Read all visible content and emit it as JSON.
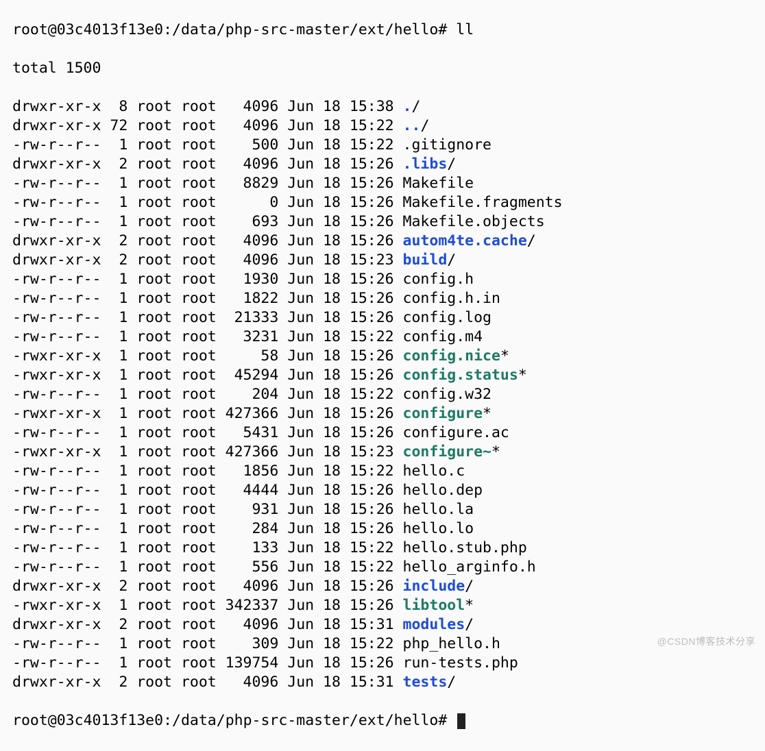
{
  "prompt": {
    "user": "root",
    "host": "03c4013f13e0",
    "path": "/data/php-src-master/ext/hello",
    "symbol": "#"
  },
  "command": "ll",
  "total_line": "total 1500",
  "colors": {
    "dir": "#1f4bd9",
    "exec": "#1d7a65"
  },
  "entries": [
    {
      "perms": "drwxr-xr-x",
      "links": 8,
      "owner": "root",
      "group": "root",
      "size": 4096,
      "date": "Jun 18 15:38",
      "name": ".",
      "suffix": "/",
      "type": "dir"
    },
    {
      "perms": "drwxr-xr-x",
      "links": 72,
      "owner": "root",
      "group": "root",
      "size": 4096,
      "date": "Jun 18 15:22",
      "name": "..",
      "suffix": "/",
      "type": "dir"
    },
    {
      "perms": "-rw-r--r--",
      "links": 1,
      "owner": "root",
      "group": "root",
      "size": 500,
      "date": "Jun 18 15:22",
      "name": ".gitignore",
      "suffix": "",
      "type": "file"
    },
    {
      "perms": "drwxr-xr-x",
      "links": 2,
      "owner": "root",
      "group": "root",
      "size": 4096,
      "date": "Jun 18 15:26",
      "name": ".libs",
      "suffix": "/",
      "type": "dir"
    },
    {
      "perms": "-rw-r--r--",
      "links": 1,
      "owner": "root",
      "group": "root",
      "size": 8829,
      "date": "Jun 18 15:26",
      "name": "Makefile",
      "suffix": "",
      "type": "file"
    },
    {
      "perms": "-rw-r--r--",
      "links": 1,
      "owner": "root",
      "group": "root",
      "size": 0,
      "date": "Jun 18 15:26",
      "name": "Makefile.fragments",
      "suffix": "",
      "type": "file"
    },
    {
      "perms": "-rw-r--r--",
      "links": 1,
      "owner": "root",
      "group": "root",
      "size": 693,
      "date": "Jun 18 15:26",
      "name": "Makefile.objects",
      "suffix": "",
      "type": "file"
    },
    {
      "perms": "drwxr-xr-x",
      "links": 2,
      "owner": "root",
      "group": "root",
      "size": 4096,
      "date": "Jun 18 15:26",
      "name": "autom4te.cache",
      "suffix": "/",
      "type": "dir"
    },
    {
      "perms": "drwxr-xr-x",
      "links": 2,
      "owner": "root",
      "group": "root",
      "size": 4096,
      "date": "Jun 18 15:23",
      "name": "build",
      "suffix": "/",
      "type": "dir"
    },
    {
      "perms": "-rw-r--r--",
      "links": 1,
      "owner": "root",
      "group": "root",
      "size": 1930,
      "date": "Jun 18 15:26",
      "name": "config.h",
      "suffix": "",
      "type": "file"
    },
    {
      "perms": "-rw-r--r--",
      "links": 1,
      "owner": "root",
      "group": "root",
      "size": 1822,
      "date": "Jun 18 15:26",
      "name": "config.h.in",
      "suffix": "",
      "type": "file"
    },
    {
      "perms": "-rw-r--r--",
      "links": 1,
      "owner": "root",
      "group": "root",
      "size": 21333,
      "date": "Jun 18 15:26",
      "name": "config.log",
      "suffix": "",
      "type": "file"
    },
    {
      "perms": "-rw-r--r--",
      "links": 1,
      "owner": "root",
      "group": "root",
      "size": 3231,
      "date": "Jun 18 15:22",
      "name": "config.m4",
      "suffix": "",
      "type": "file"
    },
    {
      "perms": "-rwxr-xr-x",
      "links": 1,
      "owner": "root",
      "group": "root",
      "size": 58,
      "date": "Jun 18 15:26",
      "name": "config.nice",
      "suffix": "*",
      "type": "exec"
    },
    {
      "perms": "-rwxr-xr-x",
      "links": 1,
      "owner": "root",
      "group": "root",
      "size": 45294,
      "date": "Jun 18 15:26",
      "name": "config.status",
      "suffix": "*",
      "type": "exec"
    },
    {
      "perms": "-rw-r--r--",
      "links": 1,
      "owner": "root",
      "group": "root",
      "size": 204,
      "date": "Jun 18 15:22",
      "name": "config.w32",
      "suffix": "",
      "type": "file"
    },
    {
      "perms": "-rwxr-xr-x",
      "links": 1,
      "owner": "root",
      "group": "root",
      "size": 427366,
      "date": "Jun 18 15:26",
      "name": "configure",
      "suffix": "*",
      "type": "exec"
    },
    {
      "perms": "-rw-r--r--",
      "links": 1,
      "owner": "root",
      "group": "root",
      "size": 5431,
      "date": "Jun 18 15:26",
      "name": "configure.ac",
      "suffix": "",
      "type": "file"
    },
    {
      "perms": "-rwxr-xr-x",
      "links": 1,
      "owner": "root",
      "group": "root",
      "size": 427366,
      "date": "Jun 18 15:23",
      "name": "configure~",
      "suffix": "*",
      "type": "exec"
    },
    {
      "perms": "-rw-r--r--",
      "links": 1,
      "owner": "root",
      "group": "root",
      "size": 1856,
      "date": "Jun 18 15:22",
      "name": "hello.c",
      "suffix": "",
      "type": "file"
    },
    {
      "perms": "-rw-r--r--",
      "links": 1,
      "owner": "root",
      "group": "root",
      "size": 4444,
      "date": "Jun 18 15:26",
      "name": "hello.dep",
      "suffix": "",
      "type": "file"
    },
    {
      "perms": "-rw-r--r--",
      "links": 1,
      "owner": "root",
      "group": "root",
      "size": 931,
      "date": "Jun 18 15:26",
      "name": "hello.la",
      "suffix": "",
      "type": "file"
    },
    {
      "perms": "-rw-r--r--",
      "links": 1,
      "owner": "root",
      "group": "root",
      "size": 284,
      "date": "Jun 18 15:26",
      "name": "hello.lo",
      "suffix": "",
      "type": "file"
    },
    {
      "perms": "-rw-r--r--",
      "links": 1,
      "owner": "root",
      "group": "root",
      "size": 133,
      "date": "Jun 18 15:22",
      "name": "hello.stub.php",
      "suffix": "",
      "type": "file"
    },
    {
      "perms": "-rw-r--r--",
      "links": 1,
      "owner": "root",
      "group": "root",
      "size": 556,
      "date": "Jun 18 15:22",
      "name": "hello_arginfo.h",
      "suffix": "",
      "type": "file"
    },
    {
      "perms": "drwxr-xr-x",
      "links": 2,
      "owner": "root",
      "group": "root",
      "size": 4096,
      "date": "Jun 18 15:26",
      "name": "include",
      "suffix": "/",
      "type": "dir"
    },
    {
      "perms": "-rwxr-xr-x",
      "links": 1,
      "owner": "root",
      "group": "root",
      "size": 342337,
      "date": "Jun 18 15:26",
      "name": "libtool",
      "suffix": "*",
      "type": "exec"
    },
    {
      "perms": "drwxr-xr-x",
      "links": 2,
      "owner": "root",
      "group": "root",
      "size": 4096,
      "date": "Jun 18 15:31",
      "name": "modules",
      "suffix": "/",
      "type": "dir"
    },
    {
      "perms": "-rw-r--r--",
      "links": 1,
      "owner": "root",
      "group": "root",
      "size": 309,
      "date": "Jun 18 15:22",
      "name": "php_hello.h",
      "suffix": "",
      "type": "file"
    },
    {
      "perms": "-rw-r--r--",
      "links": 1,
      "owner": "root",
      "group": "root",
      "size": 139754,
      "date": "Jun 18 15:26",
      "name": "run-tests.php",
      "suffix": "",
      "type": "file"
    },
    {
      "perms": "drwxr-xr-x",
      "links": 2,
      "owner": "root",
      "group": "root",
      "size": 4096,
      "date": "Jun 18 15:31",
      "name": "tests",
      "suffix": "/",
      "type": "dir"
    }
  ],
  "watermark": "@CSDN博客技术分享"
}
